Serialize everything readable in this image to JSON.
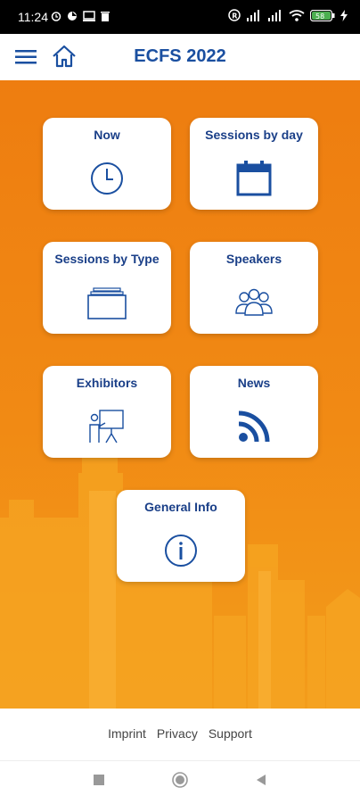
{
  "status_bar": {
    "time": "11:24",
    "battery_label": "58"
  },
  "app_bar": {
    "title": "ECFS 2022",
    "menu_icon": "hamburger-menu-icon",
    "home_icon": "home-icon"
  },
  "tiles": [
    {
      "label": "Now",
      "icon": "clock-icon"
    },
    {
      "label": "Sessions by day",
      "icon": "calendar-icon"
    },
    {
      "label": "Sessions by Type",
      "icon": "folder-stack-icon"
    },
    {
      "label": "Speakers",
      "icon": "people-icon"
    },
    {
      "label": "Exhibitors",
      "icon": "presenter-icon"
    },
    {
      "label": "News",
      "icon": "rss-icon"
    },
    {
      "label": "General Info",
      "icon": "info-icon"
    }
  ],
  "footer": {
    "imprint": "Imprint",
    "privacy": "Privacy",
    "support": "Support"
  },
  "colors": {
    "brand_blue": "#1a4fa0",
    "background_orange": "#ee7d10"
  }
}
